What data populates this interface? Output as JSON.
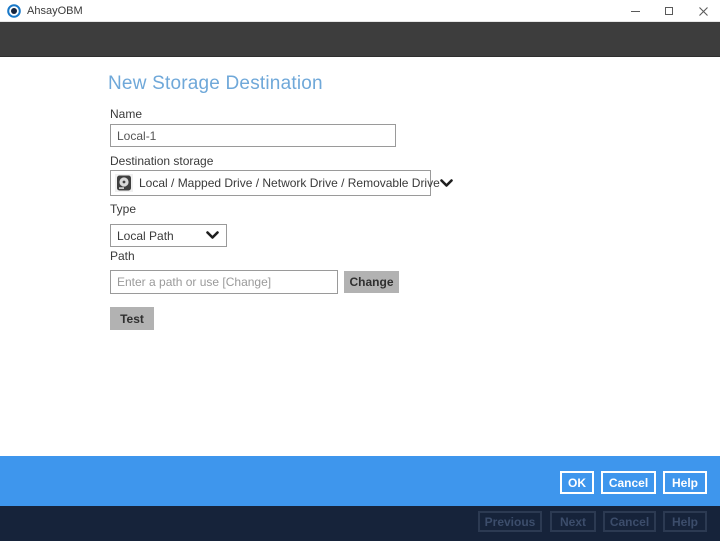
{
  "window": {
    "title": "AhsayOBM"
  },
  "page": {
    "heading": "New Storage Destination"
  },
  "form": {
    "name": {
      "label": "Name",
      "value": "Local-1"
    },
    "destination_storage": {
      "label": "Destination storage",
      "selected": "Local / Mapped Drive / Network Drive / Removable Drive",
      "icon": "hdd-icon"
    },
    "type": {
      "label": "Type",
      "selected": "Local Path"
    },
    "path": {
      "label": "Path",
      "value": "",
      "placeholder": "Enter a path or use [Change]",
      "change_label": "Change"
    },
    "test_label": "Test"
  },
  "action_bar": {
    "ok": "OK",
    "cancel": "Cancel",
    "help": "Help"
  },
  "wizard_bar": {
    "previous": "Previous",
    "next": "Next",
    "cancel": "Cancel",
    "help": "Help"
  },
  "colors": {
    "accent_blue": "#3e96ed",
    "dark_navy": "#16233a",
    "header_gray": "#3d3d3d",
    "heading_blue": "#6fa8d9",
    "button_gray": "#b2b2b2"
  }
}
